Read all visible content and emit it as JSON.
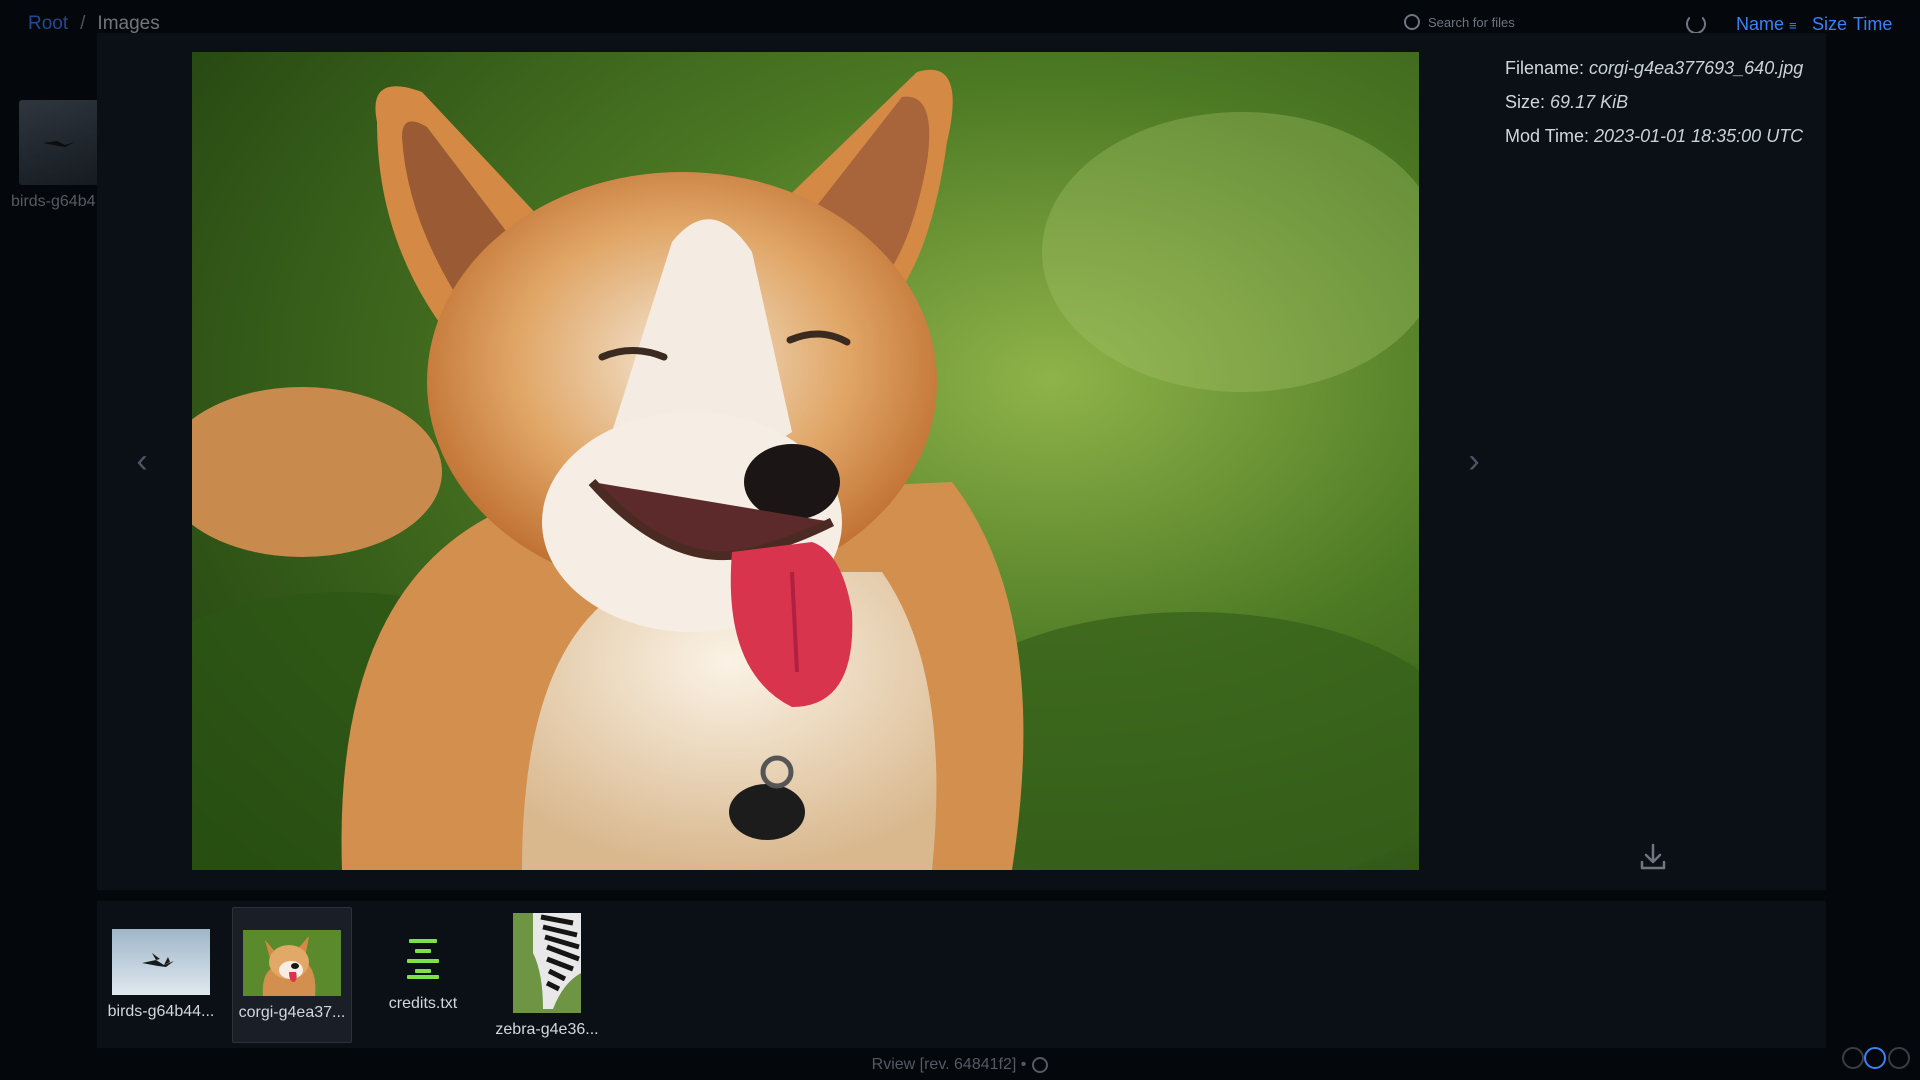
{
  "breadcrumb": {
    "root": "Root",
    "separator": "/",
    "current": "Images"
  },
  "search": {
    "placeholder": "Search for files",
    "icon": "search-icon"
  },
  "sort": {
    "name": "Name",
    "size": "Size",
    "time": "Time"
  },
  "background_item": {
    "label": "birds-g64b4"
  },
  "viewer": {
    "prev_label": "‹",
    "next_label": "›",
    "metadata": {
      "filename_label": "Filename:",
      "filename_value": "corgi-g4ea377693_640.jpg",
      "size_label": "Size:",
      "size_value": "69.17 KiB",
      "modtime_label": "Mod Time:",
      "modtime_value": "2023-01-01 18:35:00 UTC"
    }
  },
  "thumbnails": [
    {
      "label": "birds-g64b44...",
      "kind": "image",
      "selected": false
    },
    {
      "label": "corgi-g4ea37...",
      "kind": "image",
      "selected": true
    },
    {
      "label": "credits.txt",
      "kind": "text",
      "selected": false
    },
    {
      "label": "zebra-g4e36...",
      "kind": "image",
      "selected": false
    }
  ],
  "footer": {
    "text": "Rview [rev. 64841f2] •"
  },
  "colors": {
    "accent": "#3b82f6",
    "text_icon": "#7ee04a",
    "panel": "#0b0f16"
  }
}
